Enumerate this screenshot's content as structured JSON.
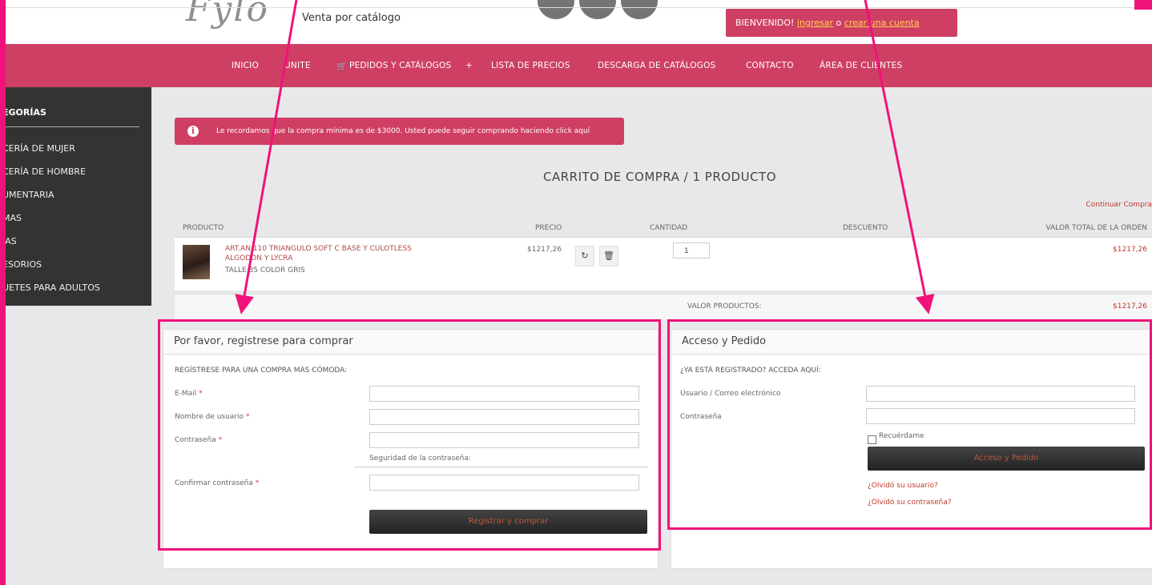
{
  "header": {
    "logo_text": "Fylo",
    "tagline": "Venta por catálogo",
    "welcome_prefix": "BIENVENIDO!",
    "login_link": "ingresar",
    "or_text": "o",
    "create_account_link": "crear una cuenta"
  },
  "nav": {
    "items": [
      "INICIO",
      "UNITE",
      "PEDIDOS Y CATÁLOGOS",
      "LISTA DE PRECIOS",
      "DESCARGA DE CATÁLOGOS",
      "CONTACTO",
      "ÁREA DE CLIENTES"
    ],
    "plus": "+"
  },
  "sidebar": {
    "title": "EGORÍAS",
    "items": [
      "CERÍA DE MUJER",
      "CERÍA DE HOMBRE",
      "UMENTARIA",
      "MAS",
      "IAS",
      "ESORIOS",
      "UETES PARA ADULTOS"
    ]
  },
  "alert": {
    "icon": "i",
    "text": "Le recordamos que la compra mínima es de $3000. Usted puede seguir comprando haciendo click aquí"
  },
  "cart": {
    "title": "CARRITO DE COMPRA / 1 PRODUCTO",
    "continue_link": "Continuar Compra",
    "headers": [
      "PRODUCTO",
      "PRECIO",
      "CANTIDAD",
      "DESCUENTO",
      "VALOR TOTAL DE LA ORDEN"
    ],
    "product": {
      "name": "ART.AN 110 TRIANGULO SOFT C BASE Y CULOTLESS ALGODON Y LYCRA",
      "meta": "TALLE 85 COLOR GRIS",
      "price": "$1217,26",
      "quantity": "1",
      "total": "$1217,26"
    },
    "summary_label": "VALOR PRODUCTOS:",
    "summary_value": "$1217,26",
    "refresh_icon": "refresh-icon",
    "delete_icon": "trash-icon"
  },
  "register": {
    "title": "Por favor, registrese para comprar",
    "subtitle": "REGÍSTRESE PARA UNA COMPRA MÁS CÓMODA:",
    "email_label": "E-Mail",
    "username_label": "Nombre de usuario",
    "password_label": "Contraseña",
    "strength_label": "Seguridad de la contraseña:",
    "confirm_label": "Confirmar contraseña",
    "required_mark": "*",
    "button": "Registrar y comprar"
  },
  "login": {
    "title": "Acceso y Pedido",
    "subtitle": "¿YA ESTÁ REGISTRADO? ACCEDA AQUÍ:",
    "user_label": "Usuario / Correo electrónico",
    "password_label": "Contraseña",
    "remember_label": "Recuérdame",
    "button": "Acceso y Pedido",
    "forgot_user": "¿Olvidó su usuario?",
    "forgot_password": "¿Olvidó su contraseña?"
  },
  "colors": {
    "brand": "#cf3f64",
    "annotation": "#f0127a",
    "sidebar": "#333333"
  }
}
